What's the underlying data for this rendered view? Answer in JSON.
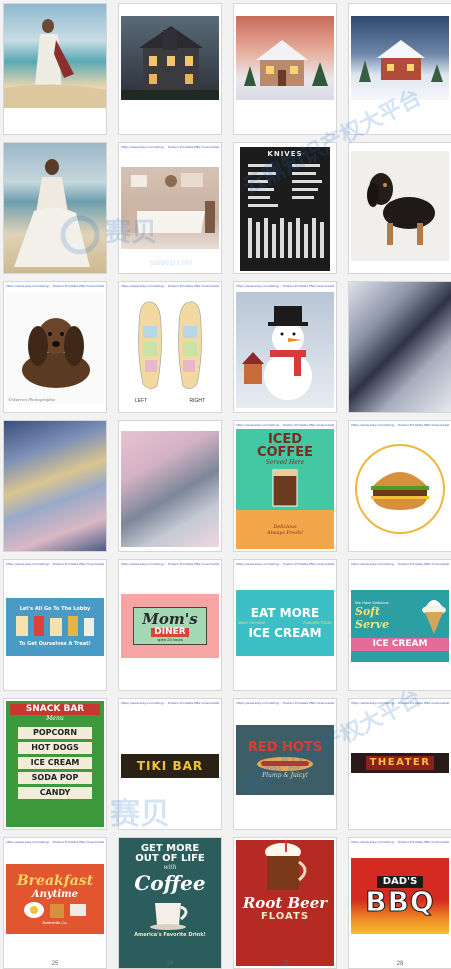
{
  "caption": "https://www.etsy.com/listing/... Posters Printable PNG Downloadable Art",
  "tiles": [
    {
      "id": 1,
      "kind": "jesus-beach"
    },
    {
      "id": 2,
      "kind": "haunted-house"
    },
    {
      "id": 3,
      "kind": "winter-cottage"
    },
    {
      "id": 4,
      "kind": "snow-cottage"
    },
    {
      "id": 5,
      "kind": "woman-beach"
    },
    {
      "id": 6,
      "kind": "bathroom"
    },
    {
      "id": 7,
      "kind": "knives",
      "title": "KNIVES"
    },
    {
      "id": 8,
      "kind": "dachshund-black"
    },
    {
      "id": 9,
      "kind": "puppy",
      "credit": "©Warren Photographic"
    },
    {
      "id": 10,
      "kind": "reflexology",
      "left": "LEFT",
      "right": "RIGHT"
    },
    {
      "id": 11,
      "kind": "snowman"
    },
    {
      "id": 12,
      "kind": "marble-dark"
    },
    {
      "id": 13,
      "kind": "marble-blue"
    },
    {
      "id": 14,
      "kind": "marble-pink"
    },
    {
      "id": 15,
      "kind": "iced-coffee",
      "title": "ICED COFFEE",
      "sub": "Served Here",
      "tag1": "Delicious",
      "tag2": "Always Fresh!"
    },
    {
      "id": 16,
      "kind": "burger"
    },
    {
      "id": 17,
      "kind": "lobby",
      "line1": "Let's All Go To The Lobby",
      "line2": "To Get Ourselves A Treat!"
    },
    {
      "id": 18,
      "kind": "moms-diner",
      "title": "Mom's",
      "sub": "DINER",
      "hours": "open 24 hours"
    },
    {
      "id": 19,
      "kind": "eat-more",
      "line1": "EAT MORE",
      "left": "MANY ON HAND",
      "right": "FLAVORS TODAY",
      "line2": "ICE CREAM"
    },
    {
      "id": 20,
      "kind": "soft-serve",
      "top": "We Have Delicious",
      "title": "Soft Serve",
      "bottom": "ICE CREAM"
    },
    {
      "id": 21,
      "kind": "snack-bar",
      "title": "SNACK BAR",
      "sub": "Menu",
      "items": [
        "POPCORN",
        "HOT DOGS",
        "ICE CREAM",
        "SODA POP",
        "CANDY"
      ]
    },
    {
      "id": 22,
      "kind": "tiki-bar",
      "title": "TIKI BAR"
    },
    {
      "id": 23,
      "kind": "red-hots",
      "title": "RED HOTS",
      "sub": "Plump & Juicy!"
    },
    {
      "id": 24,
      "kind": "theater",
      "title": "THEATER"
    },
    {
      "id": 25,
      "kind": "breakfast",
      "line1": "Breakfast",
      "line2": "Anytime",
      "brand": "Buttermilk Co."
    },
    {
      "id": 26,
      "kind": "coffee",
      "line1": "GET MORE",
      "line2": "OUT OF LIFE",
      "with": "with",
      "title": "Coffee",
      "bottom": "America's Favorite Drink!"
    },
    {
      "id": 27,
      "kind": "root-beer",
      "title": "Root Beer",
      "sub": "FLOATS"
    },
    {
      "id": 28,
      "kind": "bbq",
      "line1": "DAD'S",
      "line2": "BBQ"
    }
  ],
  "page_numbers": [
    "25",
    "26",
    "27",
    "28"
  ],
  "watermark": {
    "brand": "赛贝",
    "domain": "saibeip.com",
    "slogan": "云鼎知识产权大平台"
  }
}
